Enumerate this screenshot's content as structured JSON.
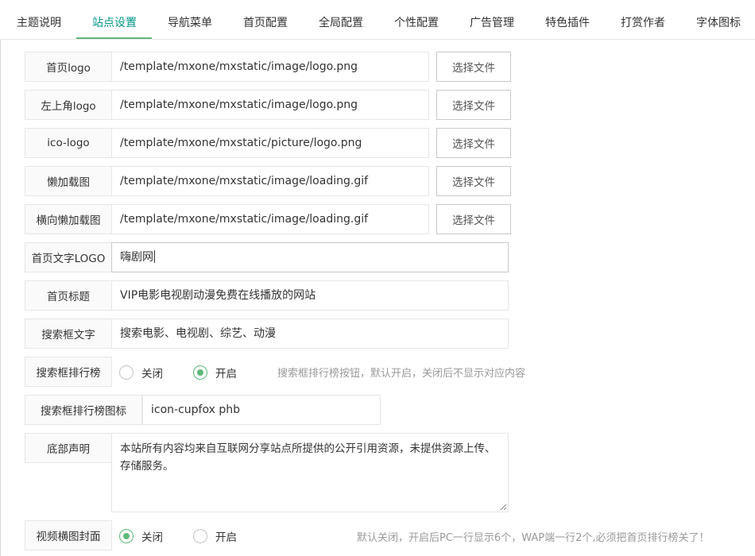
{
  "tabs": [
    {
      "label": "主题说明"
    },
    {
      "label": "站点设置"
    },
    {
      "label": "导航菜单"
    },
    {
      "label": "首页配置"
    },
    {
      "label": "全局配置"
    },
    {
      "label": "个性配置"
    },
    {
      "label": "广告管理"
    },
    {
      "label": "特色插件"
    },
    {
      "label": "打赏作者"
    },
    {
      "label": "字体图标"
    }
  ],
  "active_tab": "站点设置",
  "upload_button_label": "选择文件",
  "fields": {
    "home_logo": {
      "label": "首页logo",
      "value": "/template/mxone/mxstatic/image/logo.png"
    },
    "top_left_logo": {
      "label": "左上角logo",
      "value": "/template/mxone/mxstatic/image/logo.png"
    },
    "ico_logo": {
      "label": "ico-logo",
      "value": "/template/mxone/mxstatic/picture/logo.png"
    },
    "lazy_image": {
      "label": "懒加载图",
      "value": "/template/mxone/mxstatic/image/loading.gif"
    },
    "lazy_image_h": {
      "label": "横向懒加载图",
      "value": "/template/mxone/mxstatic/image/loading.gif"
    },
    "text_logo": {
      "label": "首页文字LOGO",
      "value": "嗨剧网"
    },
    "home_title": {
      "label": "首页标题",
      "value": "VIP电影电视剧动漫免费在线播放的网站"
    },
    "search_text": {
      "label": "搜索框文字",
      "value": "搜索电影、电视剧、综艺、动漫"
    },
    "search_rank": {
      "label": "搜索框排行榜",
      "options": [
        "关闭",
        "开启"
      ],
      "selected": "开启",
      "hint": "搜索框排行榜按钮，默认开启，关闭后不显示对应内容"
    },
    "search_rank_icon": {
      "label": "搜索框排行榜图标",
      "value": "icon-cupfox phb"
    },
    "footer_notice": {
      "label": "底部声明",
      "value": "本站所有内容均来自互联网分享站点所提供的公开引用资源，未提供资源上传、存储服务。"
    },
    "video_cover": {
      "label": "视频横图封面",
      "options": [
        "关闭",
        "开启"
      ],
      "selected": "关闭",
      "hint": "默认关闭，开启后PC一行显示6个，WAP端一行2个,必须把首页排行榜关了！"
    }
  },
  "colors": {
    "accent": "#5fb878",
    "active_tab_text": "#009688",
    "hint": "#999999"
  }
}
